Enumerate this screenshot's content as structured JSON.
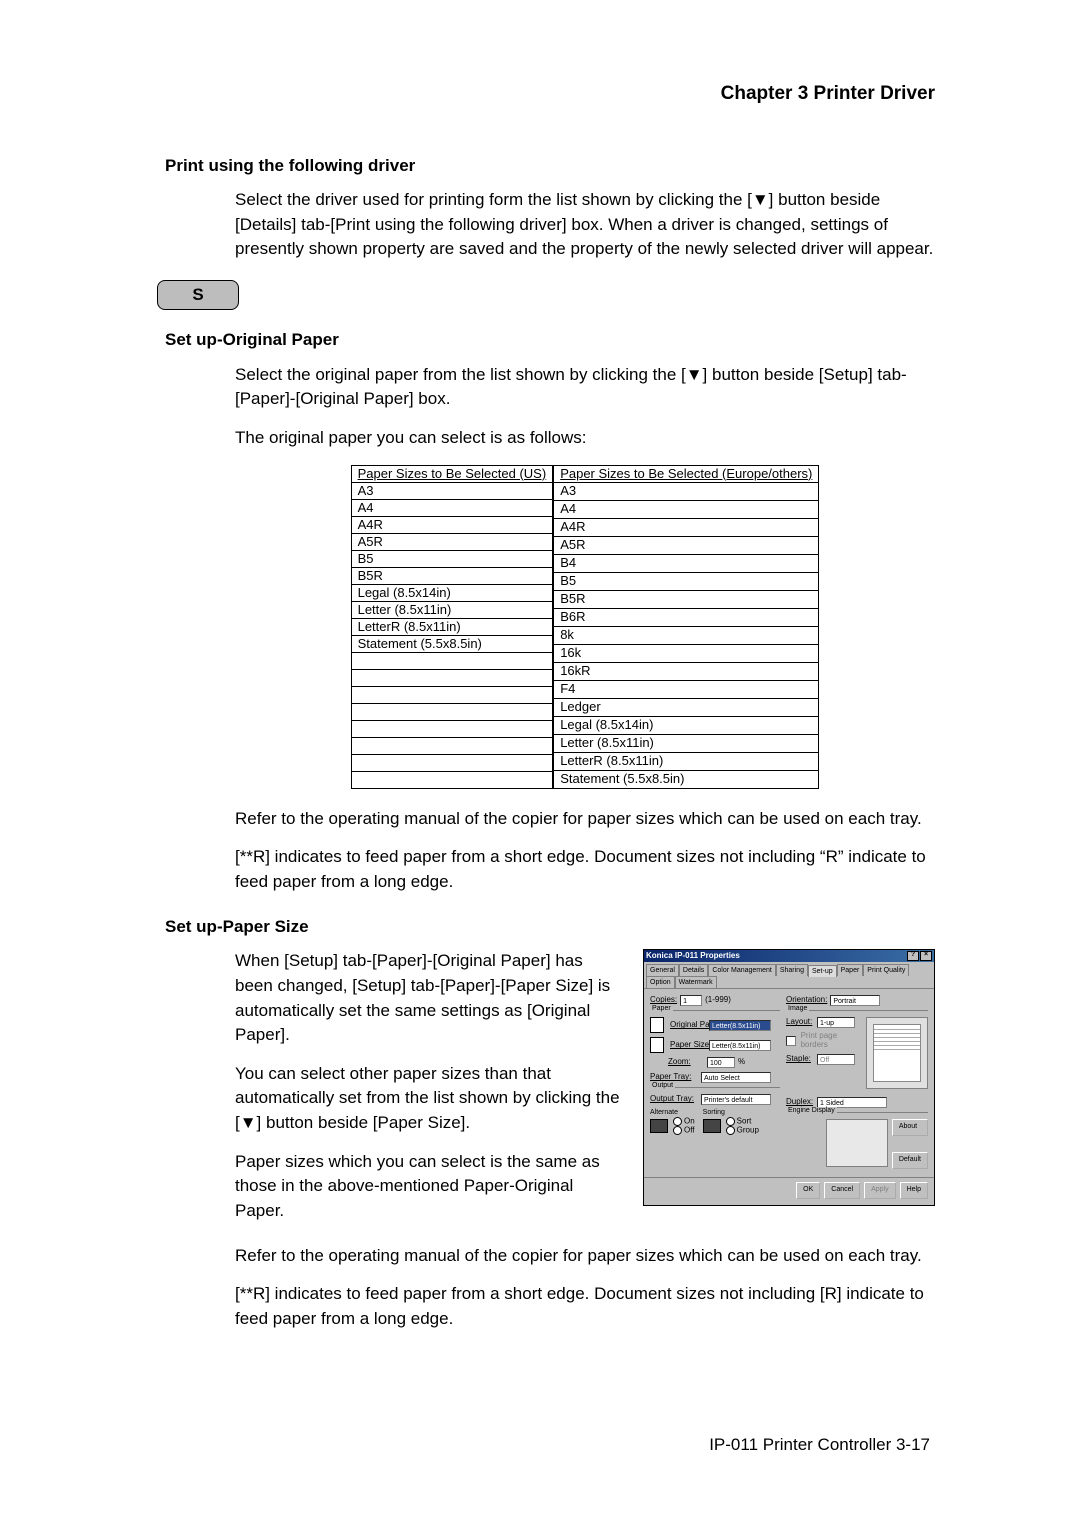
{
  "chapter": "Chapter 3  Printer Driver",
  "section1": {
    "heading": "Print using the following driver",
    "para1": "Select the driver used for printing form the list shown by clicking the [▼] button beside [Details] tab-[Print using the following driver] box.  When a driver is changed, settings of presently shown property are saved and the property of the newly selected driver will appear."
  },
  "index_letter": "S",
  "section2": {
    "heading": "Set up-Original Paper",
    "para1": "Select the original paper from the list shown by clicking the [▼] button beside [Setup] tab-[Paper]-[Original Paper] box.",
    "para2": "The original paper you can select is as follows:",
    "table_us_header": "Paper Sizes to Be Selected (US)",
    "table_eu_header": "Paper Sizes to Be Selected (Europe/others)",
    "us_sizes": [
      "A3",
      "A4",
      "A4R",
      "A5R",
      "B5",
      "B5R",
      "Legal (8.5x14in)",
      "Letter (8.5x11in)",
      "LetterR (8.5x11in)",
      "Statement (5.5x8.5in)",
      "",
      "",
      "",
      "",
      "",
      "",
      "",
      ""
    ],
    "eu_sizes": [
      "A3",
      "A4",
      "A4R",
      "A5R",
      "B4",
      "B5",
      "B5R",
      "B6R",
      "8k",
      "16k",
      "16kR",
      "F4",
      "Ledger",
      "Legal (8.5x14in)",
      "Letter (8.5x11in)",
      "LetterR (8.5x11in)",
      "Statement (5.5x8.5in)"
    ],
    "para3": "Refer to the operating manual of the copier for paper sizes which can be used on each tray.",
    "para4": "[**R] indicates to feed paper from a short edge. Document sizes not including “R” indicate to feed paper from a long edge."
  },
  "section3": {
    "heading": "Set up-Paper Size",
    "para1": "When [Setup] tab-[Paper]-[Original Paper] has been changed, [Setup] tab-[Paper]-[Paper Size] is automatically set the same settings as [Original Paper].",
    "para2": "You can select other paper sizes than that automatically set from the list shown by clicking the [▼] button beside [Paper Size].",
    "para3": "Paper sizes which you can select is the same as those in the above-mentioned Paper-Original Paper.",
    "para4": "Refer to the operating manual of the copier for paper sizes which can be used on each tray.",
    "para5": "[**R] indicates to feed paper from a short edge. Document sizes not including [R] indicate to feed paper from a long edge."
  },
  "dialog": {
    "title": "Konica IP-011 Properties",
    "tabs": [
      "General",
      "Details",
      "Color Management",
      "Sharing",
      "Set-up",
      "Paper",
      "Print Quality",
      "Option",
      "Watermark"
    ],
    "active_tab": "Set-up",
    "copies_label": "Copies:",
    "copies_value": "1",
    "copies_range": "(1-999)",
    "orientation_label": "Orientation:",
    "orientation_value": "Portrait",
    "paper_group": "Paper",
    "image_group": "Image",
    "original_paper_label": "Original Paper:",
    "original_paper_value": "Letter(8.5x11in)",
    "paper_size_label": "Paper Size:",
    "paper_size_value": "Letter(8.5x11in)",
    "zoom_label": "Zoom:",
    "zoom_value": "100",
    "zoom_unit": "%",
    "layout_label": "Layout:",
    "layout_value": "1-up",
    "border_label": "Print page borders",
    "staple_label": "Staple:",
    "staple_value": "Off",
    "paper_tray_label": "Paper Tray:",
    "paper_tray_value": "Auto Select",
    "duplex_label": "Duplex:",
    "duplex_value": "1 Sided",
    "output_group": "Output",
    "engine_group": "Engine Display",
    "output_tray_label": "Output Tray:",
    "output_tray_value": "Printer's default",
    "alternate_group": "Alternate",
    "sorting_group": "Sorting",
    "alt_on": "On",
    "alt_off": "Off",
    "sort_sort": "Sort",
    "sort_group": "Group",
    "btn_about": "About",
    "btn_default": "Default",
    "btn_ok": "OK",
    "btn_cancel": "Cancel",
    "btn_apply": "Apply",
    "btn_help": "Help"
  },
  "footer": "IP-011 Printer Controller  3-17"
}
